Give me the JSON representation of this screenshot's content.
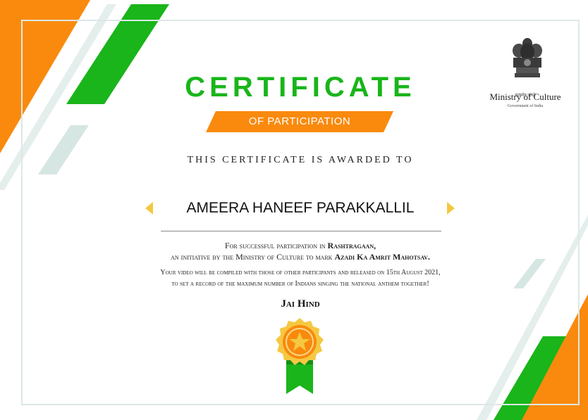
{
  "certificate": {
    "title": "CERTIFICATE",
    "subtitle": "OF PARTICIPATION",
    "awarded_to_label": "THIS CERTIFICATE IS AWARDED TO",
    "recipient_name": "AMEERA HANEEF PARAKKALLIL",
    "line1_prefix": "For successful participation in ",
    "line1_bold": "Rashtragaan,",
    "line2_prefix": "an initiative by the Ministry of Culture to mark ",
    "line2_bold": "Azadi Ka Amrit Mahotsav.",
    "line3": "Your video will be compiled with those of other participants and released on 15th August 2021,",
    "line4": "to set a record of the maximum number of Indians singing the national anthem together!",
    "closing": "Jai Hind"
  },
  "issuer": {
    "emblem_caption": "सत्यमेव जयते",
    "ministry": "Ministry of Culture",
    "government": "Government of India"
  },
  "colors": {
    "saffron": "#f98a0d",
    "green": "#19b51a",
    "pale_teal": "#d6e6e3",
    "gold": "#f5c842",
    "text": "#222222"
  },
  "icons": [
    "national-emblem-icon",
    "arrow-left-icon",
    "arrow-right-icon",
    "medal-star-icon"
  ]
}
